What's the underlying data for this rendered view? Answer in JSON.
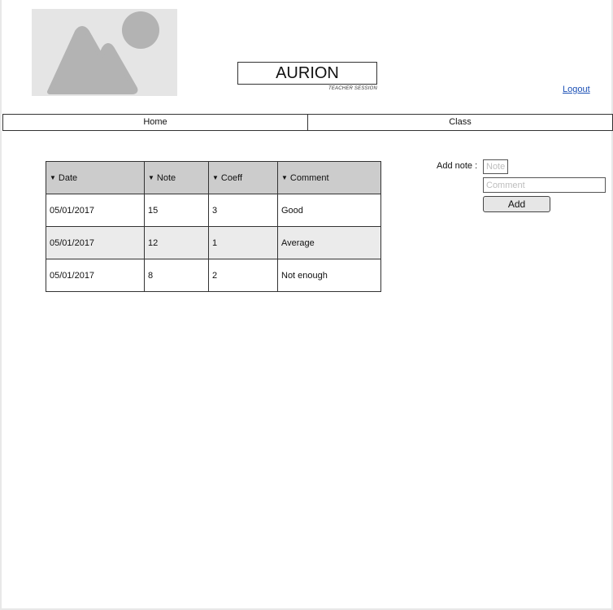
{
  "header": {
    "logo_icon": "image-placeholder-icon",
    "app_title": "AURION",
    "session_label": "TEACHER SESSION",
    "logout_label": "Logout"
  },
  "nav": {
    "tabs": [
      {
        "label": "Home"
      },
      {
        "label": "Class"
      }
    ]
  },
  "table": {
    "sort_icon": "sort-down-icon",
    "columns": [
      {
        "label": "Date"
      },
      {
        "label": "Note"
      },
      {
        "label": "Coeff"
      },
      {
        "label": "Comment"
      }
    ],
    "rows": [
      {
        "date": "05/01/2017",
        "note": "15",
        "coeff": "3",
        "comment": "Good"
      },
      {
        "date": "05/01/2017",
        "note": "12",
        "coeff": "1",
        "comment": "Average"
      },
      {
        "date": "05/01/2017",
        "note": "8",
        "coeff": "2",
        "comment": "Not enough"
      }
    ]
  },
  "add_note_form": {
    "label": "Add note :",
    "note_placeholder": "Note",
    "note_value": "",
    "comment_placeholder": "Comment",
    "comment_value": "",
    "submit_label": "Add"
  },
  "colors": {
    "header_row_bg": "#cccccc",
    "alt_row_bg": "#ebebeb",
    "link": "#1a4fb5",
    "placeholder_bg": "#e5e5e5",
    "placeholder_shape": "#b3b3b3"
  }
}
